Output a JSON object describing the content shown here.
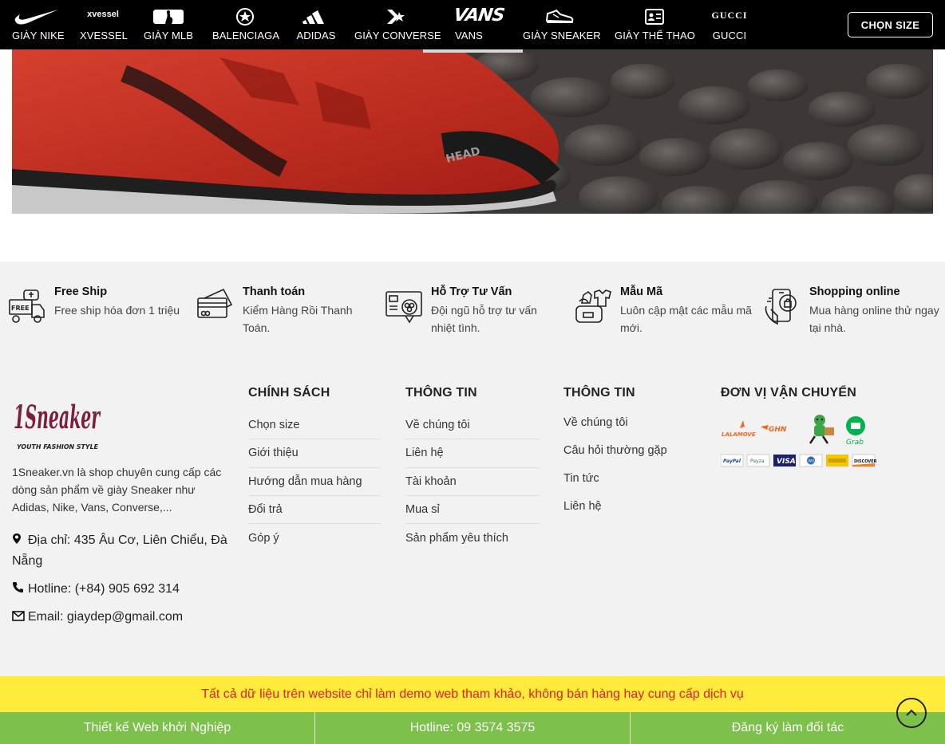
{
  "nav": {
    "items": [
      {
        "label": "GIÀY NIKE",
        "logo": "nike-swoosh-icon"
      },
      {
        "label": "XVESSEL",
        "logo_text": "xvessel"
      },
      {
        "label": "GIÀY MLB",
        "logo": "mlb-logo-icon"
      },
      {
        "label": "BALENCIAGA",
        "logo": "star-badge-icon"
      },
      {
        "label": "ADIDAS",
        "logo": "adidas-stripes-icon"
      },
      {
        "label": "GIÀY CONVERSE",
        "logo": "converse-star-icon"
      },
      {
        "label": "VANS",
        "logo_text": "VANS"
      },
      {
        "label": "GIÀY SNEAKER",
        "logo": "sneaker-shoe-icon"
      },
      {
        "label": "GIÀY THỂ THAO",
        "logo": "id-card-icon"
      },
      {
        "label": "GUCCI",
        "logo_text": "GUCCI"
      }
    ],
    "size_button": "CHỌN SIZE"
  },
  "features": [
    {
      "icon": "delivery-truck-icon",
      "title": "Free Ship",
      "desc": "Free ship hóa đơn 1 triệu",
      "icon_text": "FREE"
    },
    {
      "icon": "credit-card-icon",
      "title": "Thanh toán",
      "desc": "Kiểm Hàng Rồi Thanh Toán."
    },
    {
      "icon": "support-monitor-icon",
      "title": "Hỗ Trợ Tư Vấn",
      "desc": "Đội ngũ hỗ trợ tư vấn nhiệt tình."
    },
    {
      "icon": "clothes-bag-icon",
      "title": "Mẫu Mã",
      "desc": "Luôn cập mật các mẫu mã mới."
    },
    {
      "icon": "mobile-shopping-icon",
      "title": "Shopping online",
      "desc": "Mua hàng online thử ngay tại nhà."
    }
  ],
  "footer": {
    "brand": {
      "logo_main": "1Sneaker",
      "logo_sub": "YOUTH FASHION STYLE"
    },
    "about": "1Sneaker.vn là shop chuyên cung cấp các dòng sản phẩm về giày Sneaker như Adidas, Nike, Vans, Converse,...",
    "address": "Địa chỉ: 435 Âu Cơ, Liên Chiểu, Đà Nẵng",
    "hotline": "Hotline: (+84) 905 692 314",
    "email": "Email: giaydep@gmail.com",
    "policy": {
      "title": "CHÍNH SÁCH",
      "items": [
        "Chọn size",
        "Giới thiệu",
        "Hướng dẫn mua hàng",
        "Đổi trả",
        "Góp ý"
      ]
    },
    "info1": {
      "title": "THÔNG TIN",
      "items": [
        "Về chúng tôi",
        "Liên hệ",
        "Tài khoản",
        "Mua sỉ",
        "Sản phẩm yêu thích"
      ]
    },
    "info2": {
      "title": "THÔNG TIN",
      "items": [
        "Về chúng tôi",
        "Câu hỏi thường gặp",
        "Tin tức",
        "Liên hệ"
      ]
    },
    "shipping": {
      "title": "ĐƠN VỊ VẬN CHUYỂN",
      "carriers": [
        "LALAMOVE",
        "GHN",
        "Grab"
      ],
      "payments": [
        "PayPal",
        "Payza",
        "VISA",
        "WU",
        "DISCOVER"
      ]
    }
  },
  "notice": "Tất cả dữ liệu trên website chỉ làm demo web tham khảo, không bán hàng hay cung cấp dịch vụ",
  "bottom_bar": [
    "Thiết kế Web khởi Nghiệp",
    "Hotline: 09 3574 3575",
    "Đăng ký làm đối tác"
  ],
  "colors": {
    "nav_bg": "#000000",
    "notice_bg": "#ffeb3b",
    "notice_text": "#e02020",
    "bottom_bg": "#7dc04b",
    "brand": "#7a1f3d"
  }
}
